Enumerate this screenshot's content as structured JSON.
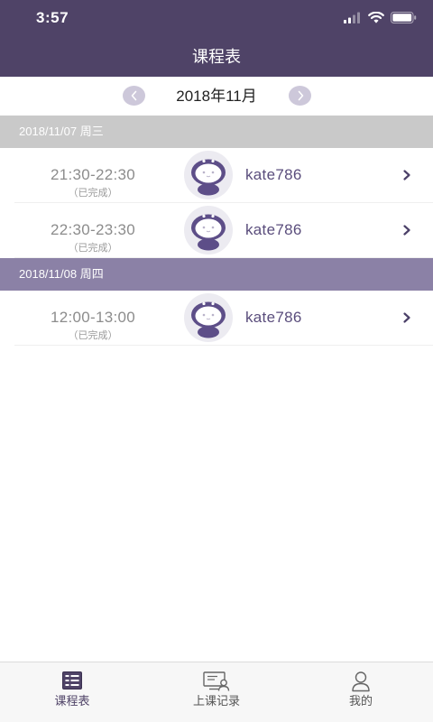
{
  "status_bar": {
    "time": "3:57",
    "icons": [
      "signal-icon",
      "wifi-icon",
      "battery-icon"
    ]
  },
  "header": {
    "title": "课程表"
  },
  "month_nav": {
    "label": "2018年11月",
    "prev_icon": "chevron-left-icon",
    "next_icon": "chevron-right-icon"
  },
  "days": [
    {
      "date": "2018/11/07 周三",
      "lessons": [
        {
          "time": "21:30-22:30",
          "status": "（已完成）",
          "teacher": "kate786",
          "avatar_icon": "robot-avatar-icon"
        },
        {
          "time": "22:30-23:30",
          "status": "（已完成）",
          "teacher": "kate786",
          "avatar_icon": "robot-avatar-icon"
        }
      ]
    },
    {
      "date": "2018/11/08 周四",
      "lessons": [
        {
          "time": "12:00-13:00",
          "status": "（已完成）",
          "teacher": "kate786",
          "avatar_icon": "robot-avatar-icon"
        }
      ]
    }
  ],
  "tabbar": {
    "items": [
      {
        "label": "课程表",
        "icon": "schedule-icon",
        "active": true
      },
      {
        "label": "上课记录",
        "icon": "class-record-icon",
        "active": false
      },
      {
        "label": "我的",
        "icon": "profile-icon",
        "active": false
      }
    ]
  },
  "colors": {
    "brand": "#4f4367",
    "month_button": "#cdc8da",
    "day_header_past": "#c9c9c9",
    "day_header_current": "#8b81a6",
    "time_text": "#8c8c8c",
    "teacher_text": "#5a4d7c",
    "avatar_purple": "#5d4e88"
  }
}
